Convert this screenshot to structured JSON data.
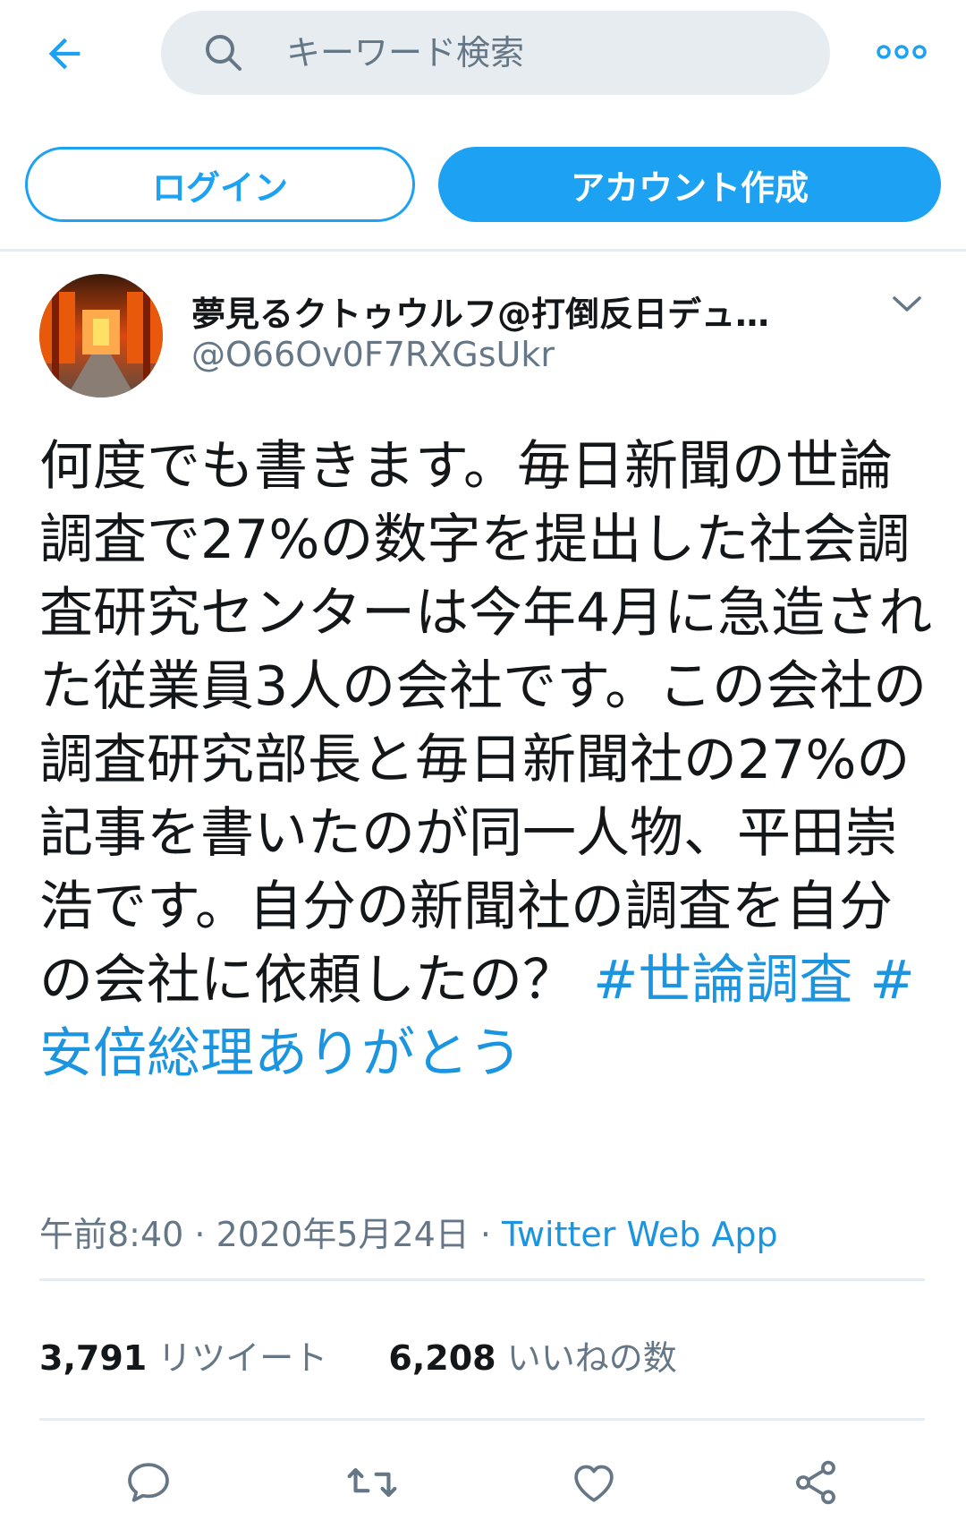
{
  "search": {
    "placeholder": "キーワード検索"
  },
  "auth": {
    "login_label": "ログイン",
    "signup_label": "アカウント作成"
  },
  "tweet": {
    "display_name": "夢見るクトゥウルフ@打倒反日デュ…",
    "handle": "@O66Ov0F7RXGsUkr",
    "text": "何度でも書きます。毎日新聞の世論調査で27%の数字を提出した社会調査研究センターは今年4月に急造された従業員3人の会社です。この会社の調査研究部長と毎日新聞社の27%の記事を書いたのが同一人物、平田崇浩です。自分の新聞社の調査を自分の会社に依頼したの？ ",
    "hashtags": [
      "#世論調査",
      "#安倍総理ありがとう"
    ],
    "time": "午前8:40 · 2020年5月24日 · ",
    "source": "Twitter Web App",
    "retweet_count": "3,791",
    "retweet_label": "リツイート",
    "like_count": "6,208",
    "like_label": "いいねの数"
  },
  "icons": {
    "back": "arrow-left-icon",
    "search": "search-icon",
    "more": "more-dots-icon",
    "caret": "chevron-down-icon",
    "reply": "reply-icon",
    "retweet": "retweet-icon",
    "like": "heart-icon",
    "share": "share-icon"
  },
  "colors": {
    "accent": "#1da1f2",
    "link": "#1b95e0",
    "muted": "#657786",
    "divider": "#e6ecf0"
  }
}
